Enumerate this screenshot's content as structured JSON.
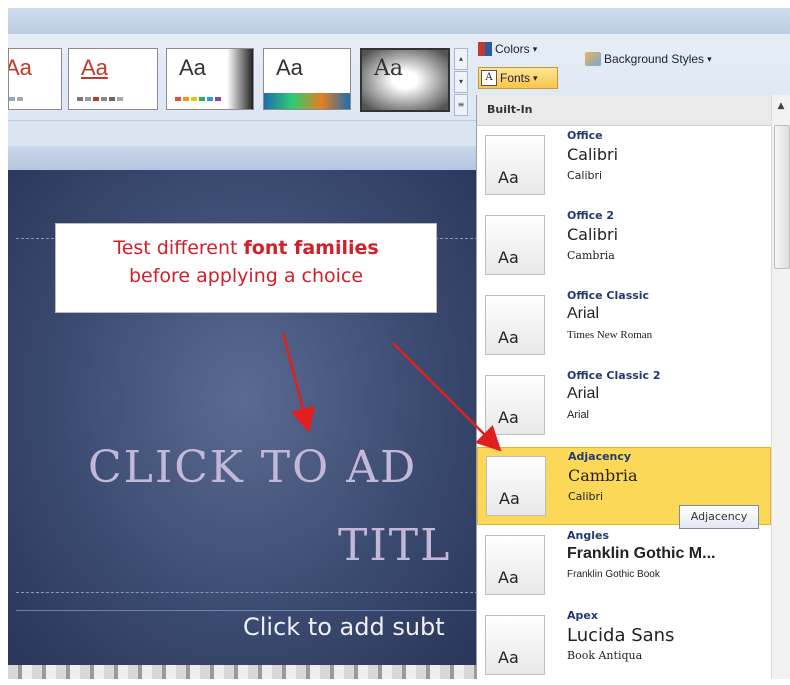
{
  "ribbon": {
    "colors_label": "Colors",
    "fonts_label": "Fonts",
    "background_styles_label": "Background Styles",
    "dropdown_arrow": "▾",
    "theme_thumbnails": [
      {
        "label": "Aa",
        "accent": "#c0392b"
      },
      {
        "label": "Aa",
        "accent": "#c0392b"
      },
      {
        "label": "Aa",
        "accent": "#222222"
      },
      {
        "label": "Aa",
        "accent": "#1f6fae"
      },
      {
        "label": "Aa",
        "accent": "#555555"
      }
    ]
  },
  "callout": {
    "line1_prefix": "Test different ",
    "line1_bold": "font families",
    "line2": "before applying  a choice",
    "color": "#d0202a"
  },
  "slide": {
    "title_line1": "CLICK TO AD",
    "title_line2": "TITL",
    "subtitle": "Click to add subt"
  },
  "fonts_dropdown": {
    "section_header": "Built-In",
    "preview_glyph": "Aa",
    "items": [
      {
        "name": "Office",
        "heading_font": "Calibri",
        "body_font": "Calibri"
      },
      {
        "name": "Office 2",
        "heading_font": "Calibri",
        "body_font": "Cambria"
      },
      {
        "name": "Office Classic",
        "heading_font": "Arial",
        "body_font": "Times New Roman"
      },
      {
        "name": "Office Classic 2",
        "heading_font": "Arial",
        "body_font": "Arial"
      },
      {
        "name": "Adjacency",
        "heading_font": "Cambria",
        "body_font": "Calibri",
        "highlighted": true
      },
      {
        "name": "Angles",
        "heading_font": "Franklin Gothic M...",
        "body_font": "Franklin Gothic Book"
      },
      {
        "name": "Apex",
        "heading_font": "Lucida Sans",
        "body_font": "Book Antiqua"
      }
    ],
    "tooltip": "Adjacency"
  },
  "colors": {
    "highlight": "#fbd857",
    "slide_bg": "#3b4a70",
    "arrow": "#e02020"
  }
}
